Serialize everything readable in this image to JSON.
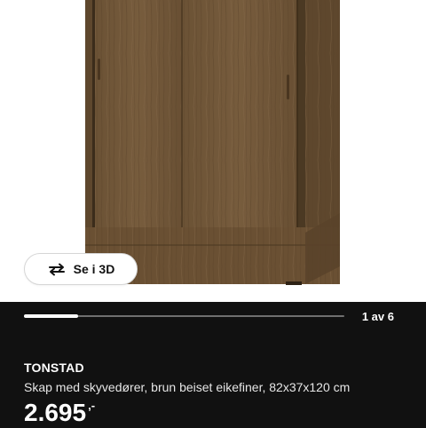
{
  "gallery": {
    "image_subject": "wardrobe-with-sliding-doors",
    "view3d_label": "Se i 3D",
    "view3d_icon": "rotate-arrows-icon",
    "progress_fraction": 0.17,
    "page_indicator": "1 av 6"
  },
  "product": {
    "name": "TONSTAD",
    "description": "Skap med skyvedører, brun beiset eikefiner, 82x37x120 cm",
    "price": "2.695",
    "price_suffix": ",-"
  },
  "colors": {
    "panel_background": "#111111",
    "wood": "#6e5436"
  }
}
